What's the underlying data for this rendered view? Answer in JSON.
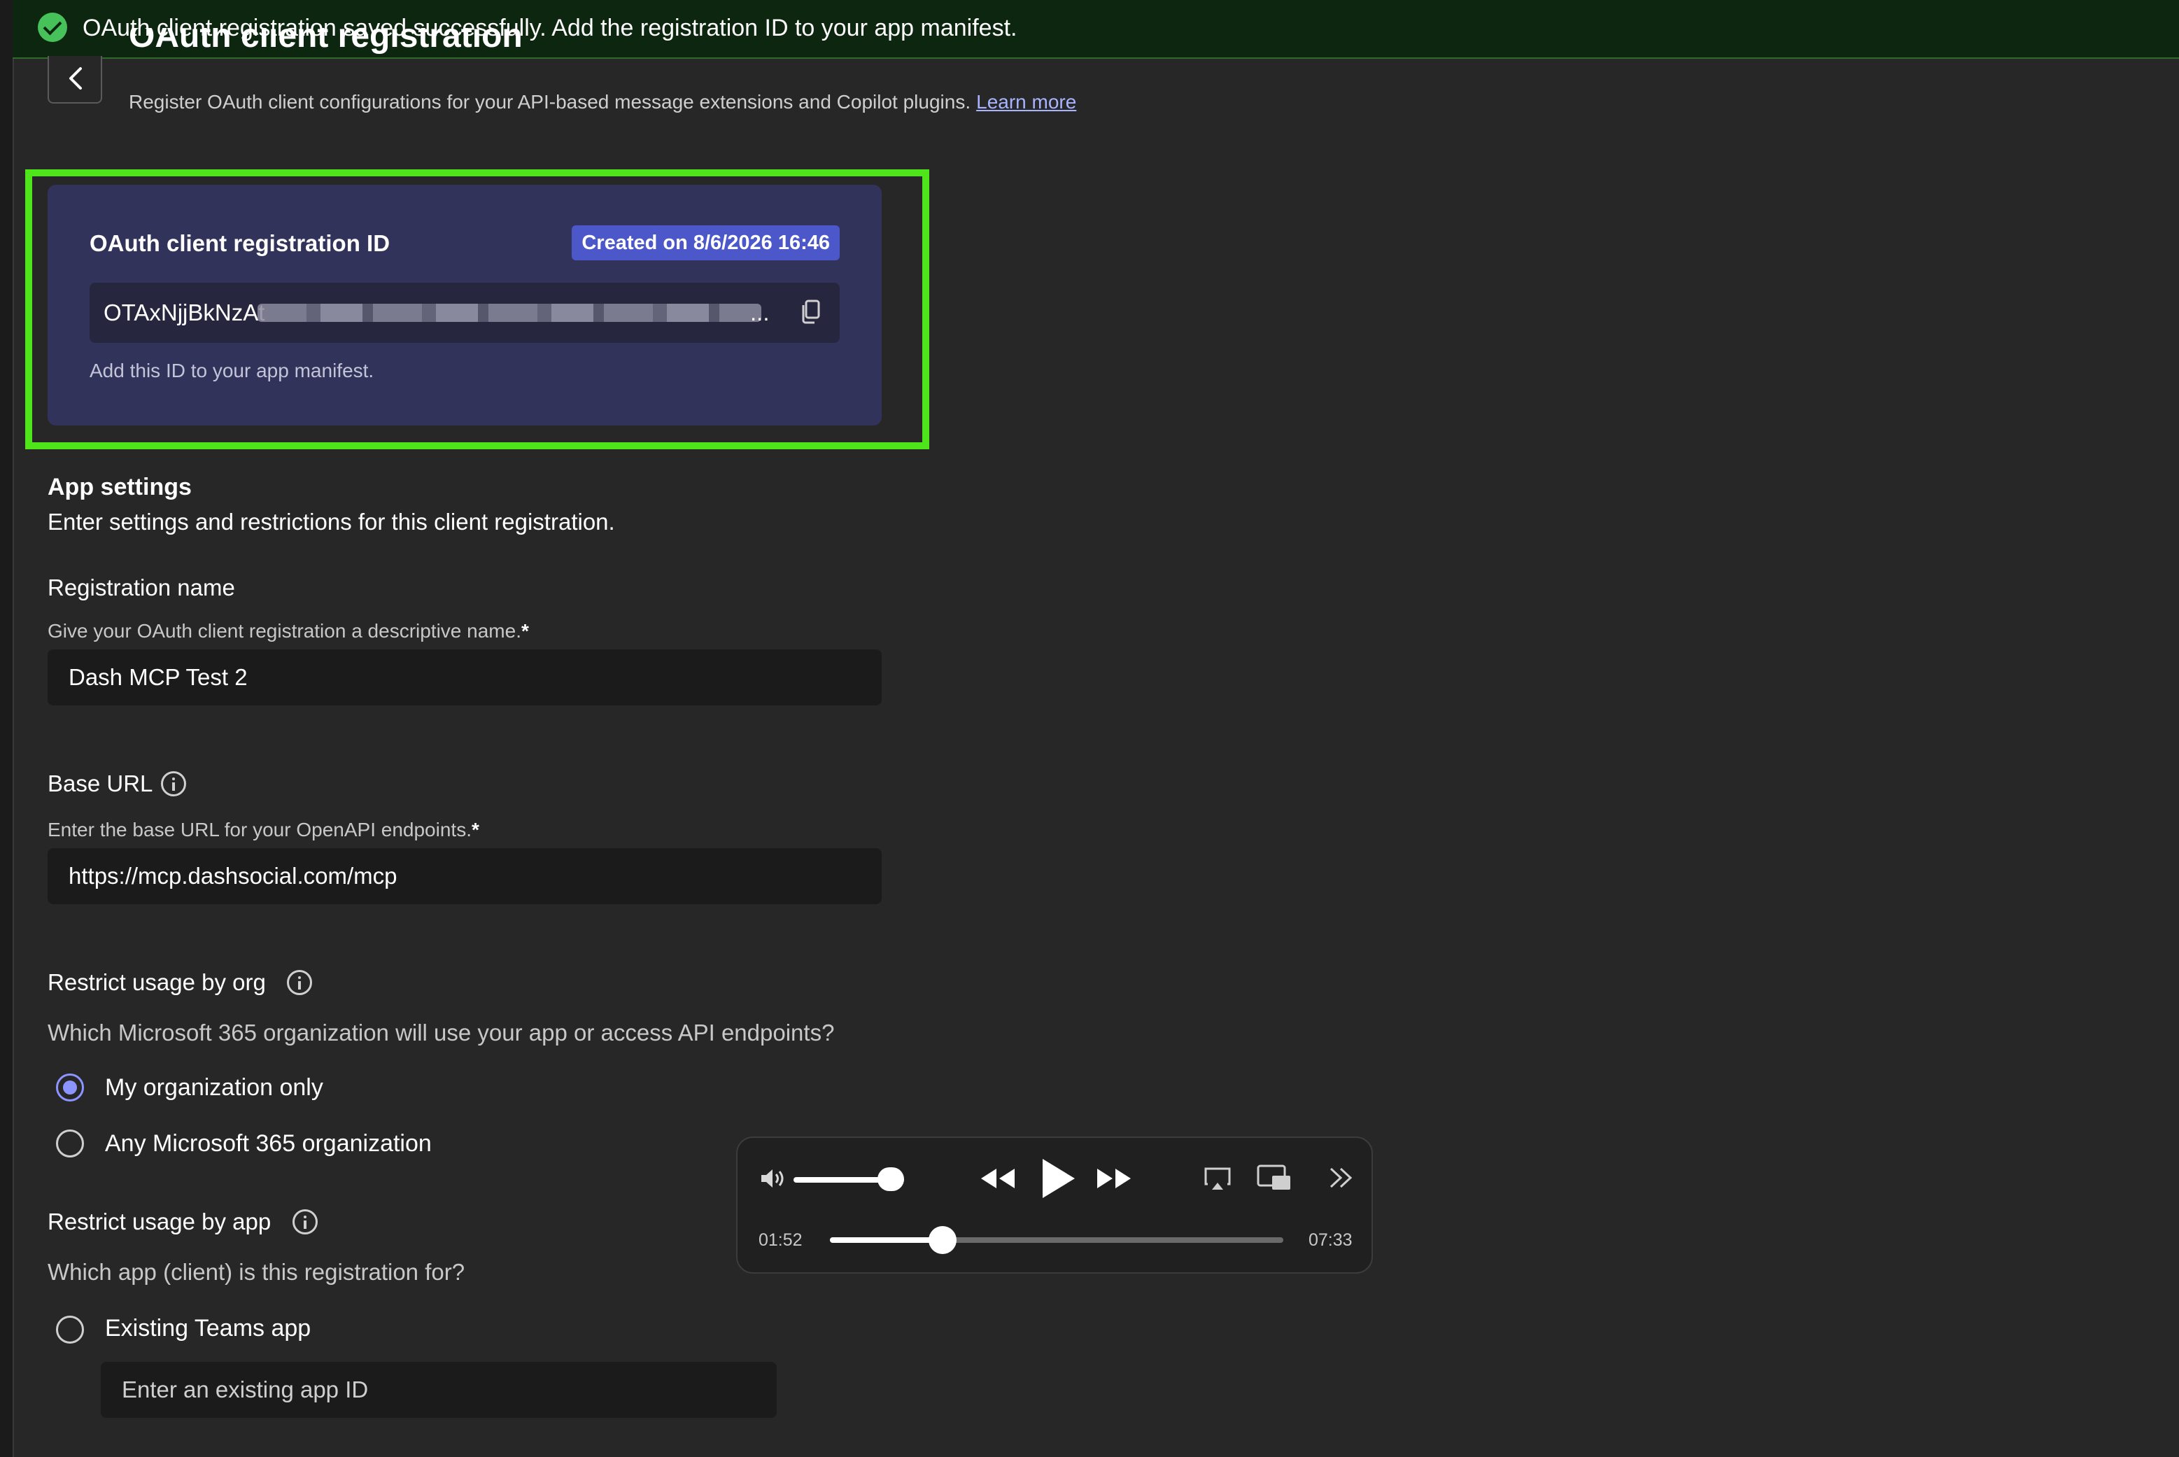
{
  "toast": {
    "message": "OAuth client registration saved successfully. Add the registration ID to your app manifest."
  },
  "header": {
    "title": "OAuth client registration",
    "subtitle": "Register OAuth client configurations for your API-based message extensions and Copilot plugins.",
    "learn_more": "Learn more"
  },
  "id_card": {
    "title": "OAuth client registration ID",
    "badge": "Created on 8/6/2026 16:46",
    "id_value": "OTAxNjjBkNzAt",
    "id_ellipsis": "...",
    "hint": "Add this ID to your app manifest."
  },
  "app_settings": {
    "title": "App settings",
    "description": "Enter settings and restrictions for this client registration."
  },
  "registration_name": {
    "label": "Registration name",
    "hint": "Give your OAuth client registration a descriptive name.",
    "required": "*",
    "value": "Dash MCP Test 2"
  },
  "base_url": {
    "label": "Base URL",
    "hint": "Enter the base URL for your OpenAPI endpoints.",
    "required": "*",
    "value": "https://mcp.dashsocial.com/mcp"
  },
  "restrict_org": {
    "label": "Restrict usage by org",
    "question": "Which Microsoft 365 organization will use your app or access API endpoints?",
    "options": [
      {
        "label": "My organization only",
        "selected": true
      },
      {
        "label": "Any Microsoft 365 organization",
        "selected": false
      }
    ]
  },
  "restrict_app": {
    "label": "Restrict usage by app",
    "question": "Which app (client) is this registration for?",
    "options": [
      {
        "label": "Existing Teams app",
        "selected": false
      }
    ],
    "app_id_placeholder": "Enter an existing app ID"
  },
  "media_player": {
    "current_time": "01:52",
    "total_time": "07:33",
    "progress_fraction": 0.248,
    "volume_fraction": 1.0
  },
  "colors": {
    "accent": "#8c94ff",
    "highlight": "#4fe51b",
    "badge": "#4c57c9",
    "success": "#47c15a"
  }
}
